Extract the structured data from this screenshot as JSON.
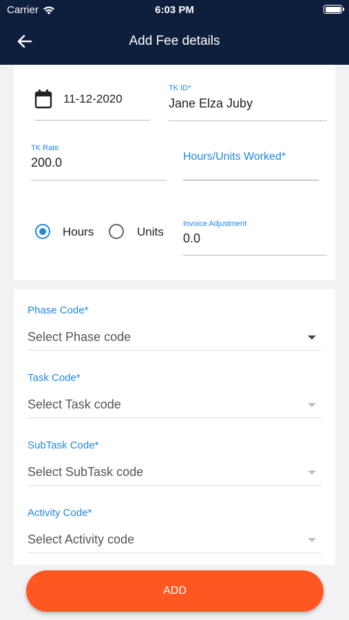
{
  "status_bar": {
    "carrier": "Carrier",
    "time": "6:03 PM"
  },
  "header": {
    "title": "Add Fee details",
    "back_icon": "arrow-left-icon"
  },
  "form": {
    "date": "11-12-2020",
    "tk_id": {
      "label": "TK ID*",
      "value": "Jane Elza Juby"
    },
    "tk_rate": {
      "label": "TK Rate",
      "value": "200.0"
    },
    "hours_units": {
      "label": "Hours/Units Worked*",
      "value": ""
    },
    "mode": {
      "options": [
        "Hours",
        "Units"
      ],
      "selected": "Hours"
    },
    "invoice_adjustment": {
      "label": "Invoice Adjustment",
      "value": "0.0"
    }
  },
  "codes": [
    {
      "label": "Phase Code*",
      "placeholder": "Select Phase code"
    },
    {
      "label": "Task Code*",
      "placeholder": "Select Task code"
    },
    {
      "label": "SubTask Code*",
      "placeholder": "Select SubTask code"
    },
    {
      "label": "Activity Code*",
      "placeholder": "Select Activity code"
    }
  ],
  "actions": {
    "add_label": "ADD"
  },
  "colors": {
    "header_bg": "#0e1e3d",
    "accent": "#1e88e5",
    "button": "#ff5722"
  }
}
